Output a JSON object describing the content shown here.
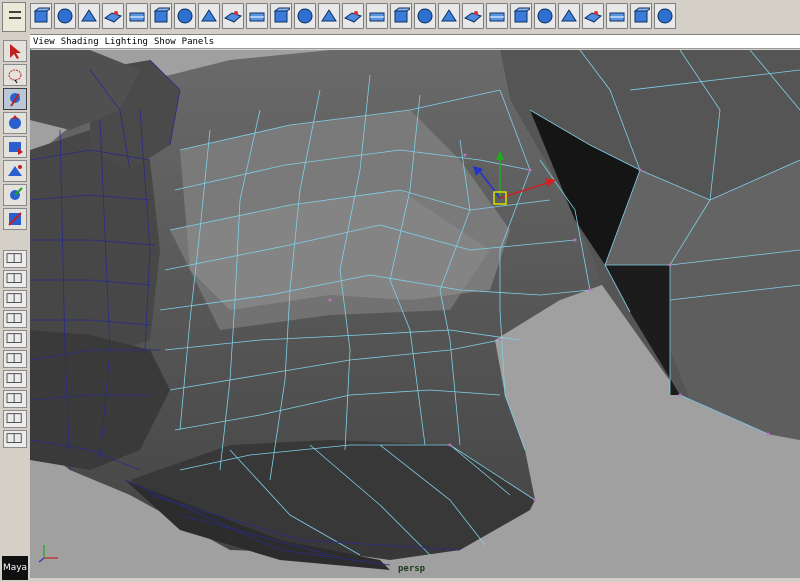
{
  "shelf": {
    "icons": [
      "polygon-cube-icon",
      "polygon-sphere-icon",
      "polygon-cylinder-icon",
      "polygon-cone-icon",
      "polygon-plane-icon",
      "polygon-torus-icon",
      "combine-icon",
      "separate-icon",
      "boolean-icon",
      "smooth-proxy-icon",
      "extrude-face-icon",
      "extrude-edge-icon",
      "split-polygon-icon",
      "cut-faces-icon",
      "wedge-icon",
      "bevel-icon",
      "poke-icon",
      "merge-icon",
      "delete-edge-icon",
      "append-polygon-icon",
      "bridge-icon",
      "fill-hole-icon",
      "mirror-icon",
      "checker-map-icon",
      "checker-map-alt-icon",
      "uv-checker-icon",
      "uv-layout-icon"
    ]
  },
  "toolbox": {
    "tools": [
      {
        "name": "select-tool-icon"
      },
      {
        "name": "lasso-tool-icon"
      },
      {
        "name": "paint-select-tool-icon"
      },
      {
        "name": "move-tool-icon"
      },
      {
        "name": "rotate-tool-icon"
      },
      {
        "name": "scale-tool-icon"
      },
      {
        "name": "manipulator-tool-icon"
      },
      {
        "name": "last-tool-icon"
      }
    ]
  },
  "menu": {
    "view": "View",
    "shading": "Shading",
    "lighting": "Lighting",
    "show": "Show",
    "panels": "Panels"
  },
  "viewport": {
    "camera_label": "persp",
    "background": "#a0a0a0",
    "wire_color": "#7fd0e8",
    "edge_dark_color": "#2a2a8a"
  },
  "logo_text": "Maya"
}
